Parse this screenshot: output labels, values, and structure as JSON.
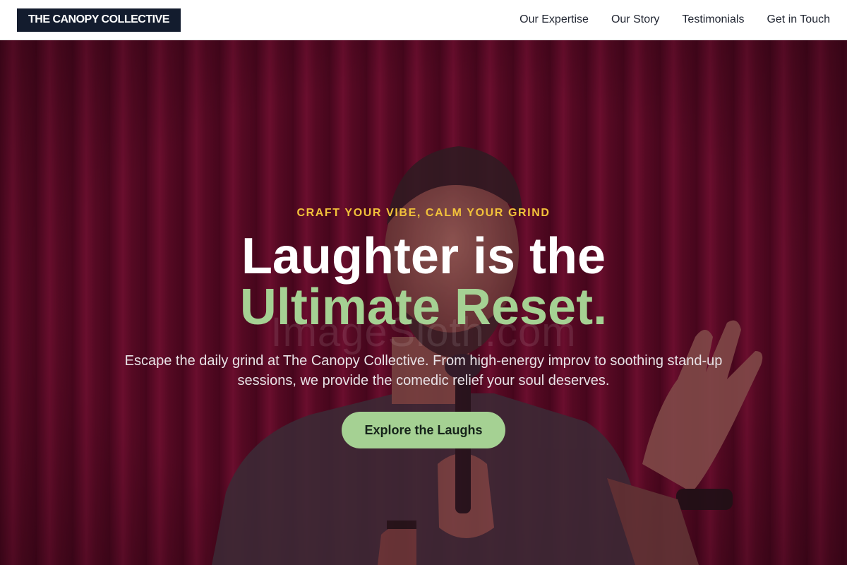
{
  "brand": {
    "name": "THE CANOPY COLLECTIVE"
  },
  "nav": {
    "links": [
      "Our Expertise",
      "Our Story",
      "Testimonials",
      "Get in Touch"
    ]
  },
  "hero": {
    "eyebrow": "CRAFT YOUR VIBE, CALM YOUR GRIND",
    "headline_line1": "Laughter is the",
    "headline_line2": "Ultimate Reset.",
    "subtitle": "Escape the daily grind at The Canopy Collective. From high-energy improv to soothing stand-up sessions, we provide the comedic relief your soul deserves.",
    "cta_label": "Explore the Laughs",
    "watermark": "ImageSloth.com"
  },
  "colors": {
    "brand_dark": "#131c2e",
    "eyebrow_gold": "#f2c23a",
    "accent_green": "#a5d193",
    "curtain_red": "#6b0d2c"
  }
}
